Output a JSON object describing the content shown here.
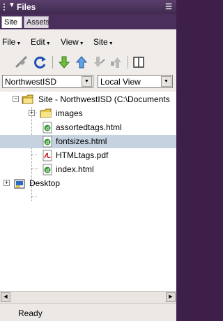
{
  "panel": {
    "title": "Files",
    "tabs": [
      {
        "label": "Site",
        "active": true
      },
      {
        "label": "Assets",
        "active": false
      }
    ]
  },
  "menus": [
    {
      "label": "File"
    },
    {
      "label": "Edit"
    },
    {
      "label": "View"
    },
    {
      "label": "Site"
    }
  ],
  "toolbar": {
    "buttons": [
      "connect-icon",
      "refresh-icon",
      "get-icon",
      "put-icon",
      "check-out-icon",
      "check-in-icon",
      "expand-icon"
    ]
  },
  "site_select": {
    "value": "NorthwestISD"
  },
  "view_select": {
    "value": "Local View"
  },
  "tree": {
    "root": {
      "label": "Site - NorthwestISD (C:\\Documents"
    },
    "items": [
      {
        "label": "images",
        "type": "folder"
      },
      {
        "label": "assortedtags.html",
        "type": "html"
      },
      {
        "label": "fontsizes.html",
        "type": "html",
        "selected": true
      },
      {
        "label": "HTMLtags.pdf",
        "type": "pdf"
      },
      {
        "label": "index.html",
        "type": "html"
      }
    ],
    "desktop": {
      "label": "Desktop"
    }
  },
  "status": {
    "text": "Ready"
  },
  "colors": {
    "panel_header": "#4a2e5c",
    "selection": "#c6d2e0",
    "folder": "#e8c84a",
    "html_icon": "#2e8b2e",
    "pdf_icon": "#cc2222"
  }
}
